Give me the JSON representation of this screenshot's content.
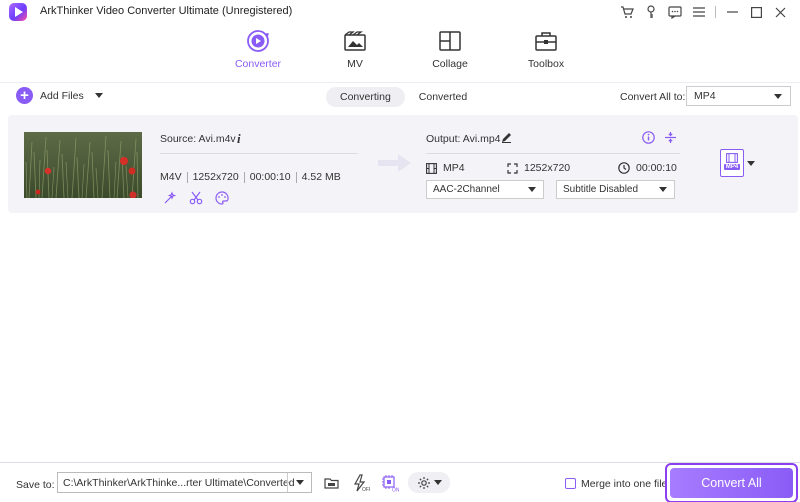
{
  "app": {
    "title": "ArkThinker Video Converter Ultimate (Unregistered)",
    "accent": "#8a5cf6"
  },
  "nav": [
    {
      "label": "Converter",
      "icon": "converter-icon",
      "active": true
    },
    {
      "label": "MV",
      "icon": "mv-icon",
      "active": false
    },
    {
      "label": "Collage",
      "icon": "collage-icon",
      "active": false
    },
    {
      "label": "Toolbox",
      "icon": "toolbox-icon",
      "active": false
    }
  ],
  "toolbar": {
    "add_files_label": "Add Files",
    "tabs": [
      "Converting",
      "Converted"
    ],
    "convert_all_to_label": "Convert All to:",
    "format_value": "MP4"
  },
  "file": {
    "source_label": "Source: Avi.m4v",
    "format": "M4V",
    "resolution": "1252x720",
    "duration": "00:00:10",
    "size": "4.52 MB",
    "output_label": "Output: Avi.mp4",
    "out_format": "MP4",
    "out_resolution": "1252x720",
    "out_duration": "00:00:10",
    "audio_value": "AAC-2Channel",
    "subtitle_value": "Subtitle Disabled",
    "format_badge": "MP4"
  },
  "bottom": {
    "save_to_label": "Save to:",
    "path_value": "C:\\ArkThinker\\ArkThinke...rter Ultimate\\Converted",
    "merge_label": "Merge into one file",
    "convert_all_label": "Convert All"
  }
}
